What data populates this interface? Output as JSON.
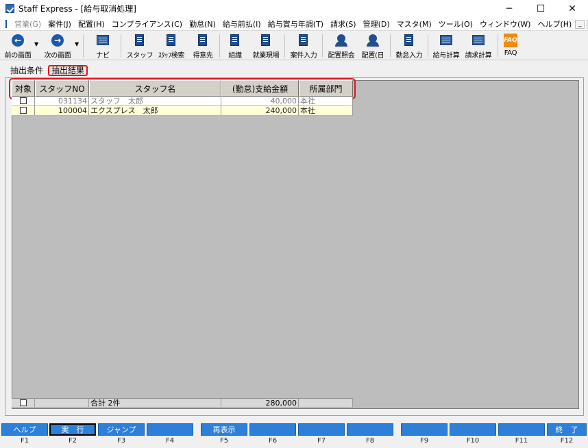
{
  "window": {
    "title": "Staff Express - [給与取消処理]",
    "minimize": "─",
    "maximize": "☐",
    "close": "✕"
  },
  "menu": {
    "items": [
      {
        "label": "営業(G)",
        "disabled": true
      },
      {
        "label": "案件(J)"
      },
      {
        "label": "配置(H)"
      },
      {
        "label": "コンプライアンス(C)"
      },
      {
        "label": "勤怠(N)"
      },
      {
        "label": "給与前払(I)"
      },
      {
        "label": "給与賞与年調(T)"
      },
      {
        "label": "請求(S)"
      },
      {
        "label": "管理(D)"
      },
      {
        "label": "マスタ(M)"
      },
      {
        "label": "ツール(O)"
      },
      {
        "label": "ウィンドウ(W)"
      },
      {
        "label": "ヘルプ(H)"
      }
    ],
    "mdi": [
      "_",
      "🗗",
      "×"
    ]
  },
  "toolbar": {
    "back": "前の画面",
    "forward": "次の画面",
    "navi": "ナビ",
    "staff": "スタッフ",
    "staff_search": "ｽﾀｯﾌ検索",
    "client": "得意先",
    "org": "組織",
    "worksite": "就業現場",
    "case_input": "案件入力",
    "placement_inquiry": "配置照会",
    "placement_day": "配置(日",
    "attendance_input": "勤怠入力",
    "payroll_calc": "給与計算",
    "billing_calc": "請求計算",
    "faq": "FAQ",
    "faq_icon_text": "FAQ",
    "dropdown_arrow": "▼"
  },
  "tabs": {
    "conditions": "抽出条件",
    "results": "抽出結果"
  },
  "table": {
    "headers": [
      "対象",
      "スタッフNO",
      "スタッフ名",
      "(勤怠)支給金額",
      "所属部門"
    ],
    "rows": [
      {
        "staff_no": "031134",
        "name": "スタッフ　太郎",
        "amount": "40,000",
        "dept": "本社"
      },
      {
        "staff_no": "100004",
        "name": "エクスプレス　太郎",
        "amount": "240,000",
        "dept": "本社"
      }
    ],
    "totals": {
      "label": "合計 2件",
      "amount": "280,000"
    }
  },
  "fkeys": [
    {
      "label": "ヘルプ",
      "key": "F1"
    },
    {
      "label": "実　行",
      "key": "F2",
      "selected": true
    },
    {
      "label": "ジャンプ",
      "key": "F3"
    },
    {
      "label": "",
      "key": "F4"
    },
    {
      "label": "再表示",
      "key": "F5"
    },
    {
      "label": "",
      "key": "F6"
    },
    {
      "label": "",
      "key": "F7"
    },
    {
      "label": "",
      "key": "F8"
    },
    {
      "label": "",
      "key": "F9"
    },
    {
      "label": "",
      "key": "F10"
    },
    {
      "label": "",
      "key": "F11"
    },
    {
      "label": "終　了",
      "key": "F12"
    }
  ]
}
